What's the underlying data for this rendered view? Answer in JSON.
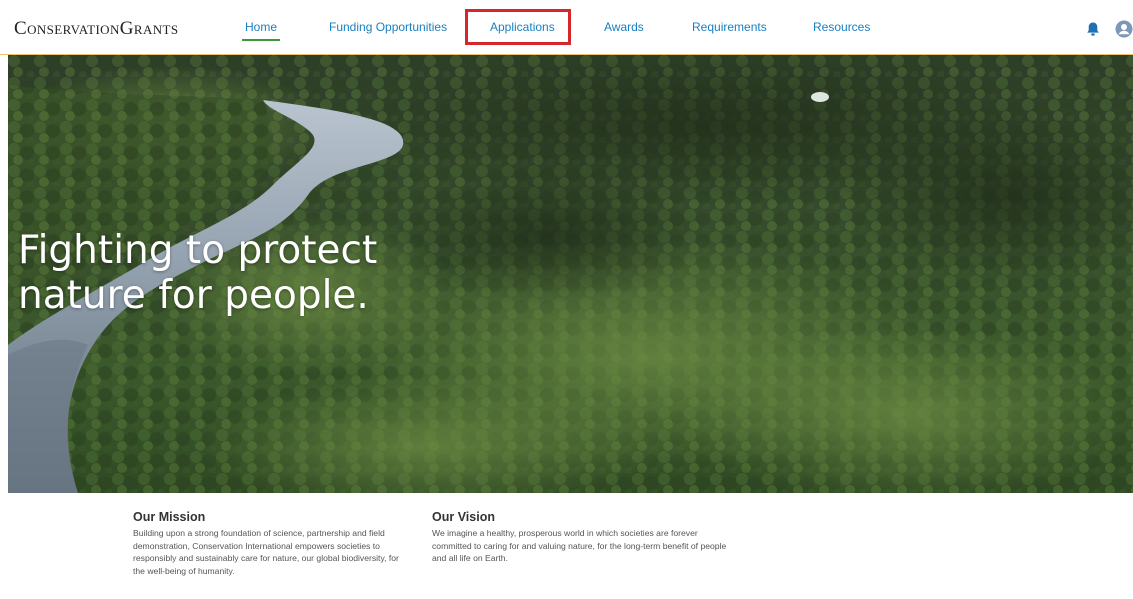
{
  "header": {
    "brand": "ConservationGrants",
    "nav": [
      {
        "label": "Home",
        "active": true
      },
      {
        "label": "Funding Opportunities",
        "active": false
      },
      {
        "label": "Applications",
        "active": false,
        "highlighted": true
      },
      {
        "label": "Awards",
        "active": false
      },
      {
        "label": "Requirements",
        "active": false
      },
      {
        "label": "Resources",
        "active": false
      }
    ],
    "icons": [
      "bell-icon",
      "user-avatar-icon"
    ]
  },
  "hero": {
    "title_line1": "Fighting to protect",
    "title_line2": "nature for people."
  },
  "mission": {
    "heading": "Our Mission",
    "text": "Building upon a strong foundation of science, partnership and field demonstration, Conservation International empowers societies to responsibly and sustainably care for nature, our global biodiversity, for the well-being of humanity."
  },
  "vision": {
    "heading": "Our Vision",
    "text": "We imagine a healthy, prosperous world in which societies are forever committed to caring for and valuing nature, for the long-term benefit of people and all life on Earth."
  },
  "colors": {
    "nav_link": "#1a7fc0",
    "active_underline": "#3a9a3a",
    "highlight_box": "#d6262b",
    "header_border": "#f0c36a"
  }
}
